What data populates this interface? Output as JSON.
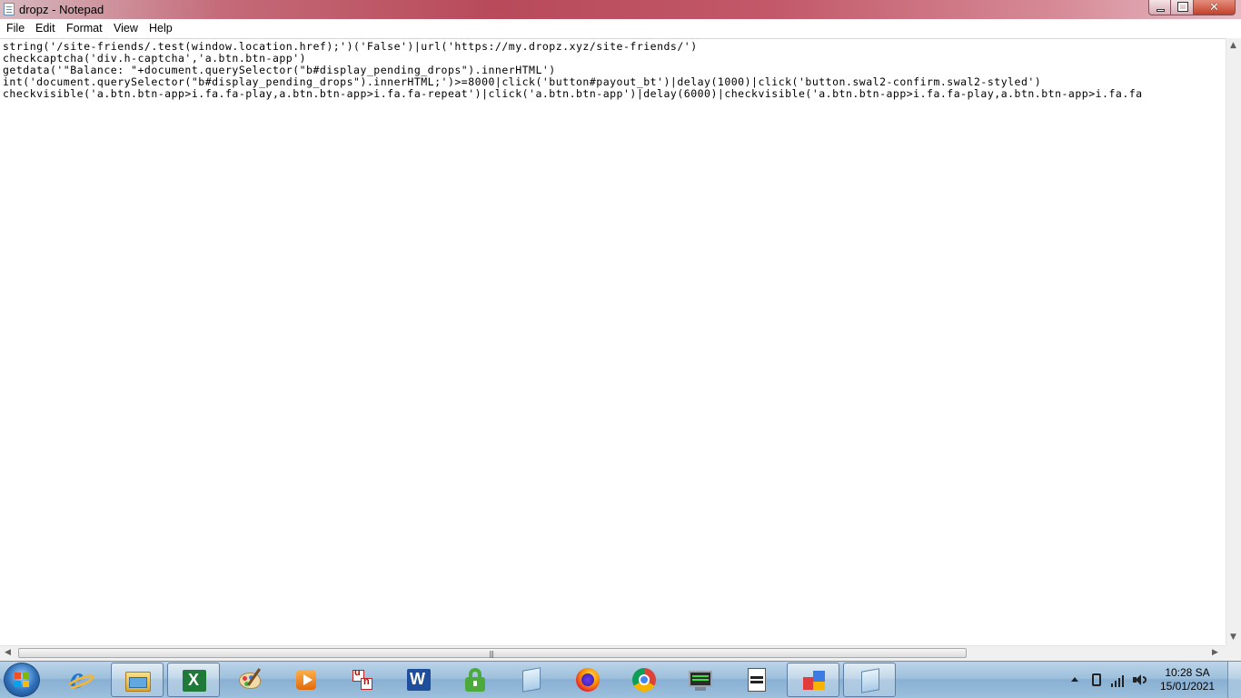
{
  "window": {
    "title": "dropz - Notepad",
    "close_glyph": "✕"
  },
  "menu": {
    "items": [
      "File",
      "Edit",
      "Format",
      "View",
      "Help"
    ]
  },
  "editor": {
    "lines": [
      "string('/site-friends/.test(window.location.href);')('False')|url('https://my.dropz.xyz/site-friends/')",
      "checkcaptcha('div.h-captcha','a.btn.btn-app')",
      "getdata('\"Balance: \"+document.querySelector(\"b#display_pending_drops\").innerHTML')",
      "int('document.querySelector(\"b#display_pending_drops\").innerHTML;')>=8000|click('button#payout_bt')|delay(1000)|click('button.swal2-confirm.swal2-styled')",
      "checkvisible('a.btn.btn-app>i.fa.fa-play,a.btn.btn-app>i.fa.fa-repeat')|click('a.btn.btn-app')|delay(6000)|checkvisible('a.btn.btn-app>i.fa.fa-play,a.btn.btn-app>i.fa.fa"
    ]
  },
  "scrollbar": {
    "up": "▲",
    "down": "▼",
    "left": "◀",
    "right": "▶",
    "grip": "|||"
  },
  "taskbar": {
    "apps": [
      {
        "icon": "internet-explorer-icon"
      },
      {
        "icon": "file-explorer-icon"
      },
      {
        "icon": "excel-icon"
      },
      {
        "icon": "paint-icon"
      },
      {
        "icon": "media-player-icon"
      },
      {
        "icon": "unikey-icon"
      },
      {
        "icon": "word-icon"
      },
      {
        "icon": "vpn-lock-icon"
      },
      {
        "icon": "notepad-icon"
      },
      {
        "icon": "firefox-icon"
      },
      {
        "icon": "chrome-icon"
      },
      {
        "icon": "network-tool-icon"
      },
      {
        "icon": "document-viewer-icon"
      },
      {
        "icon": "windows-app-icon"
      },
      {
        "icon": "notepad-icon"
      }
    ],
    "ie_glyph": "e",
    "excel_glyph": "X",
    "word_glyph": "W",
    "unikey_glyph_1": "u",
    "unikey_glyph_2": "n"
  },
  "tray": {
    "time": "10:28 SA",
    "date": "15/01/2021"
  }
}
